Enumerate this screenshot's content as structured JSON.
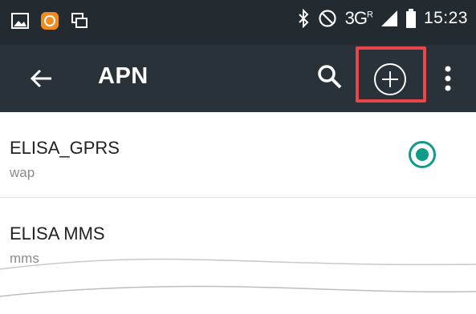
{
  "status_bar": {
    "time": "15:23",
    "network_label": "3G",
    "network_sup": "R",
    "icons": [
      "gallery-icon",
      "app-notification-icon",
      "screenshot-icon",
      "bluetooth-icon",
      "do-not-disturb-icon",
      "signal-icon",
      "battery-icon"
    ]
  },
  "toolbar": {
    "title": "APN",
    "icons": [
      "back-arrow-icon",
      "search-icon",
      "add-circle-icon",
      "more-vert-icon"
    ]
  },
  "apn_list": [
    {
      "name": "ELISA_GPRS",
      "type": "wap",
      "selected": true
    },
    {
      "name": "ELISA MMS",
      "type": "mms",
      "selected": false
    }
  ],
  "colors": {
    "status_bar": "#232b30",
    "toolbar": "#283238",
    "accent": "#0e9c89",
    "highlight": "#ea4549"
  }
}
